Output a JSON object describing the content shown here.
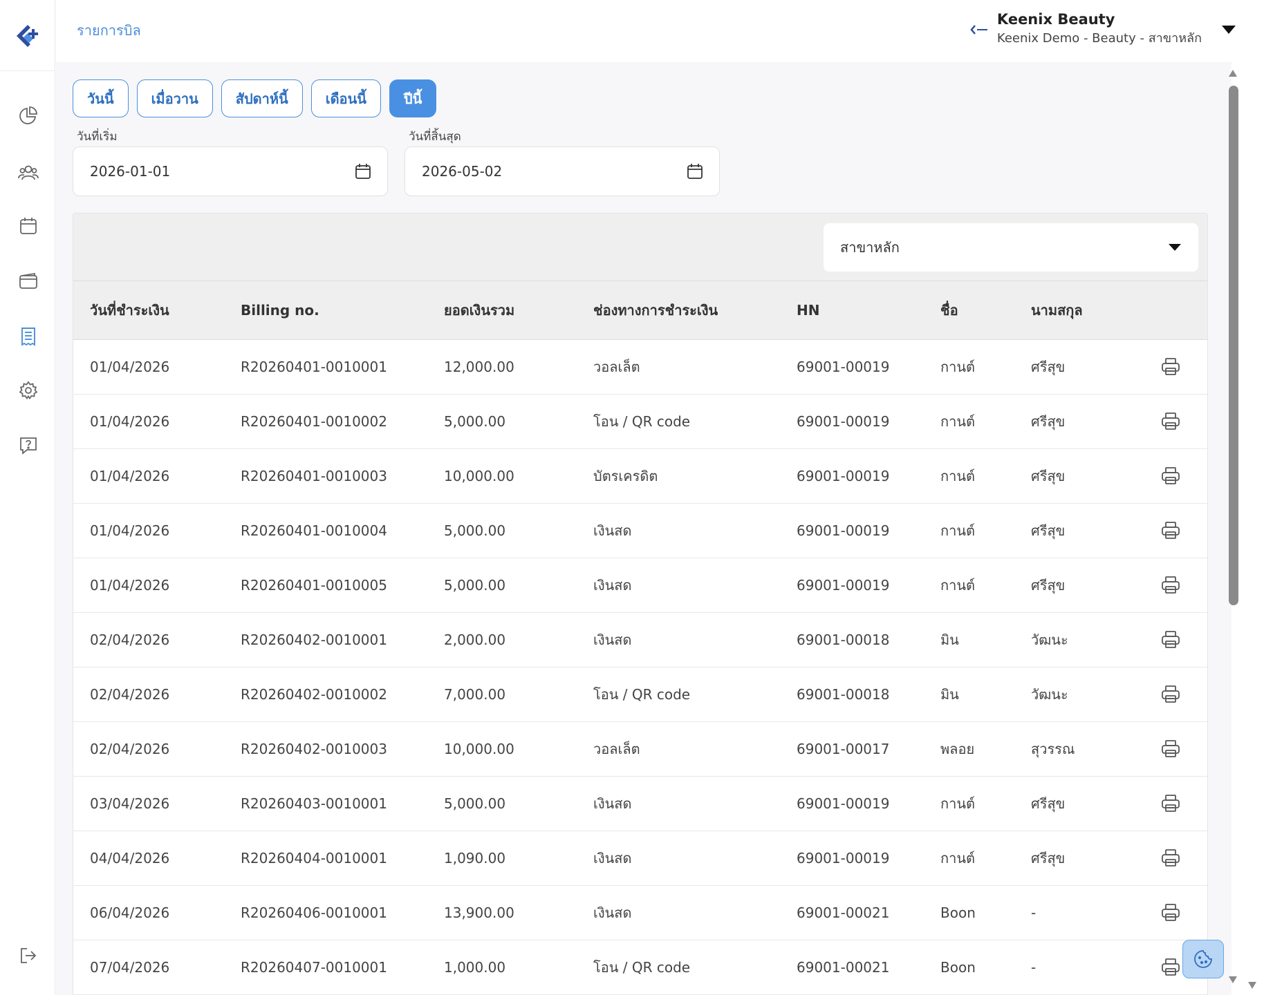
{
  "header": {
    "breadcrumb": "รายการบิล",
    "account_name": "Keenix Beauty",
    "account_sub": "Keenix Demo - Beauty - สาขาหลัก"
  },
  "sidebar": {
    "items": [
      {
        "icon": "chart-pie-icon"
      },
      {
        "icon": "users-icon"
      },
      {
        "icon": "calendar-icon"
      },
      {
        "icon": "wallet-icon"
      },
      {
        "icon": "receipt-icon",
        "active": true
      },
      {
        "icon": "gear-icon"
      },
      {
        "icon": "help-chat-icon"
      }
    ],
    "logout_icon": "logout-icon"
  },
  "quick_range": {
    "buttons": [
      "วันนี้",
      "เมื่อวาน",
      "สัปดาห์นี้",
      "เดือนนี้",
      "ปีนี้"
    ],
    "active_index": 4
  },
  "dates": {
    "start_label": "วันที่เริ่ม",
    "start_value": "2026-01-01",
    "end_label": "วันที่สิ้นสุด",
    "end_value": "2026-05-02"
  },
  "filter": {
    "branch_value": "สาขาหลัก"
  },
  "table": {
    "columns": [
      "วันที่ชำระเงิน",
      "Billing no.",
      "ยอดเงินรวม",
      "ช่องทางการชำระเงิน",
      "HN",
      "ชื่อ",
      "นามสกุล"
    ],
    "rows": [
      [
        "01/04/2026",
        "R20260401-0010001",
        "12,000.00",
        "วอลเล็ต",
        "69001-00019",
        "กานต์",
        "ศรีสุข"
      ],
      [
        "01/04/2026",
        "R20260401-0010002",
        "5,000.00",
        "โอน / QR code",
        "69001-00019",
        "กานต์",
        "ศรีสุข"
      ],
      [
        "01/04/2026",
        "R20260401-0010003",
        "10,000.00",
        "บัตรเครดิต",
        "69001-00019",
        "กานต์",
        "ศรีสุข"
      ],
      [
        "01/04/2026",
        "R20260401-0010004",
        "5,000.00",
        "เงินสด",
        "69001-00019",
        "กานต์",
        "ศรีสุข"
      ],
      [
        "01/04/2026",
        "R20260401-0010005",
        "5,000.00",
        "เงินสด",
        "69001-00019",
        "กานต์",
        "ศรีสุข"
      ],
      [
        "02/04/2026",
        "R20260402-0010001",
        "2,000.00",
        "เงินสด",
        "69001-00018",
        "มิน",
        "วัฒนะ"
      ],
      [
        "02/04/2026",
        "R20260402-0010002",
        "7,000.00",
        "โอน / QR code",
        "69001-00018",
        "มิน",
        "วัฒนะ"
      ],
      [
        "02/04/2026",
        "R20260402-0010003",
        "10,000.00",
        "วอลเล็ต",
        "69001-00017",
        "พลอย",
        "สุวรรณ"
      ],
      [
        "03/04/2026",
        "R20260403-0010001",
        "5,000.00",
        "เงินสด",
        "69001-00019",
        "กานต์",
        "ศรีสุข"
      ],
      [
        "04/04/2026",
        "R20260404-0010001",
        "1,090.00",
        "เงินสด",
        "69001-00019",
        "กานต์",
        "ศรีสุข"
      ],
      [
        "06/04/2026",
        "R20260406-0010001",
        "13,900.00",
        "เงินสด",
        "69001-00021",
        "Boon",
        "-"
      ],
      [
        "07/04/2026",
        "R20260407-0010001",
        "1,000.00",
        "โอน / QR code",
        "69001-00021",
        "Boon",
        "-"
      ]
    ]
  },
  "colors": {
    "accent": "#4a90e2",
    "link": "#4a8fd9",
    "sidebar_active": "#4a8fd9"
  }
}
